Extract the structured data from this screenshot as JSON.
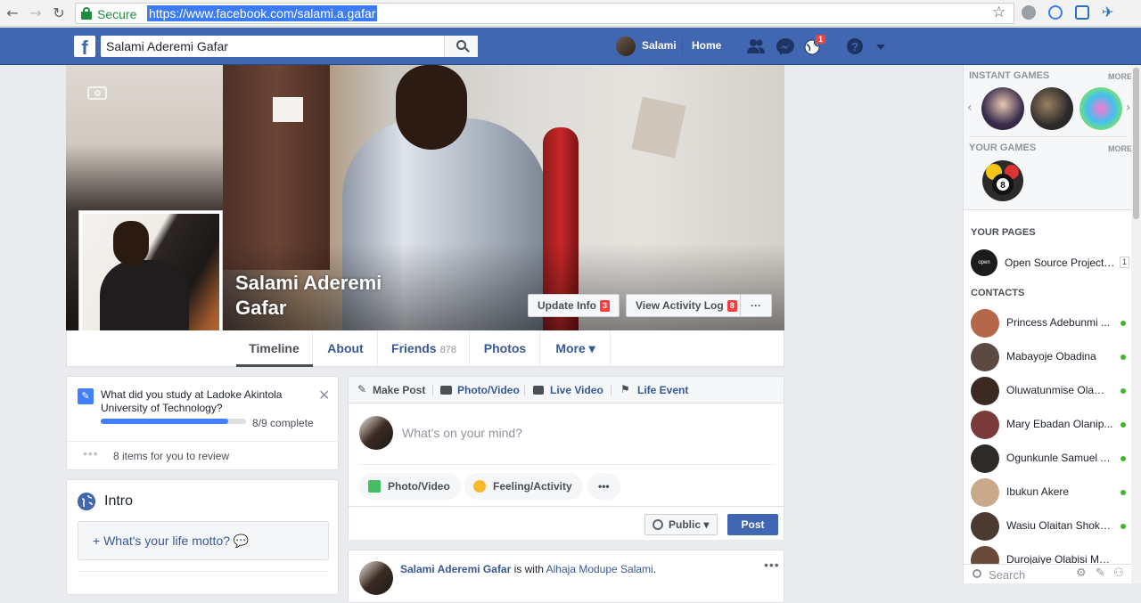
{
  "browser": {
    "secure_label": "Secure",
    "url": "https://www.facebook.com/salami.a.gafar"
  },
  "topbar": {
    "logo": "f",
    "search_value": "Salami Aderemi Gafar",
    "user_name": "Salami",
    "home_label": "Home",
    "notification_count": "1"
  },
  "profile": {
    "name": "Salami Aderemi Gafar",
    "update_info_label": "Update Info",
    "update_info_badge": "3",
    "activity_log_label": "View Activity Log",
    "activity_log_badge": "8",
    "more_dots": "···"
  },
  "tabs": {
    "timeline": "Timeline",
    "about": "About",
    "friends": "Friends",
    "friends_count": "878",
    "photos": "Photos",
    "more": "More ▾"
  },
  "study_prompt": {
    "question": "What did you study at Ladoke Akintola University of Technology?",
    "progress_fraction": 0.875,
    "complete_text": "8/9 complete",
    "review_text": "8 items for you to review",
    "dots": "•••"
  },
  "intro": {
    "title": "Intro",
    "motto_prompt": "+  What's your life motto? 💬"
  },
  "composer": {
    "make_post": "Make Post",
    "photo_video": "Photo/Video",
    "live_video": "Live Video",
    "life_event": "Life Event",
    "placeholder": "What's on your mind?",
    "pill_photo": "Photo/Video",
    "pill_feeling": "Feeling/Activity",
    "pill_more": "•••",
    "audience": "Public ▾",
    "post_label": "Post"
  },
  "feed": {
    "author": "Salami Aderemi Gafar",
    "with_text": " is with ",
    "tagged": "Alhaja Modupe Salami",
    "more": "•••"
  },
  "sidebar": {
    "instant_games": "INSTANT GAMES",
    "more": "MORE",
    "your_games": "YOUR GAMES",
    "your_pages": "YOUR PAGES",
    "page_name": "Open Source Projects...",
    "page_count": "1",
    "page_avatar_text": "open source",
    "contacts_header": "CONTACTS",
    "contacts": [
      {
        "name": "Princess Adebunmi ...",
        "color": "#b5674a"
      },
      {
        "name": "Mabayoje Obadina",
        "color": "#5a4a42"
      },
      {
        "name": "Oluwatunmise Olami...",
        "color": "#3a2a22"
      },
      {
        "name": "Mary Ebadan Olanip...",
        "color": "#7a3a3a"
      },
      {
        "name": "Ogunkunle Samuel A...",
        "color": "#2e2a28"
      },
      {
        "name": "Ibukun Akere",
        "color": "#c9a98a"
      },
      {
        "name": "Wasiu Olaitan Shokoya",
        "color": "#4a3a30"
      },
      {
        "name": "Durojaiye Olabisi Mo...",
        "color": "#6a4a3a"
      }
    ],
    "search_label": "Search"
  },
  "colors": {
    "fb_blue": "#4267b2",
    "link_blue": "#365899",
    "online_green": "#42b72a",
    "badge_red": "#fa3e3e"
  }
}
